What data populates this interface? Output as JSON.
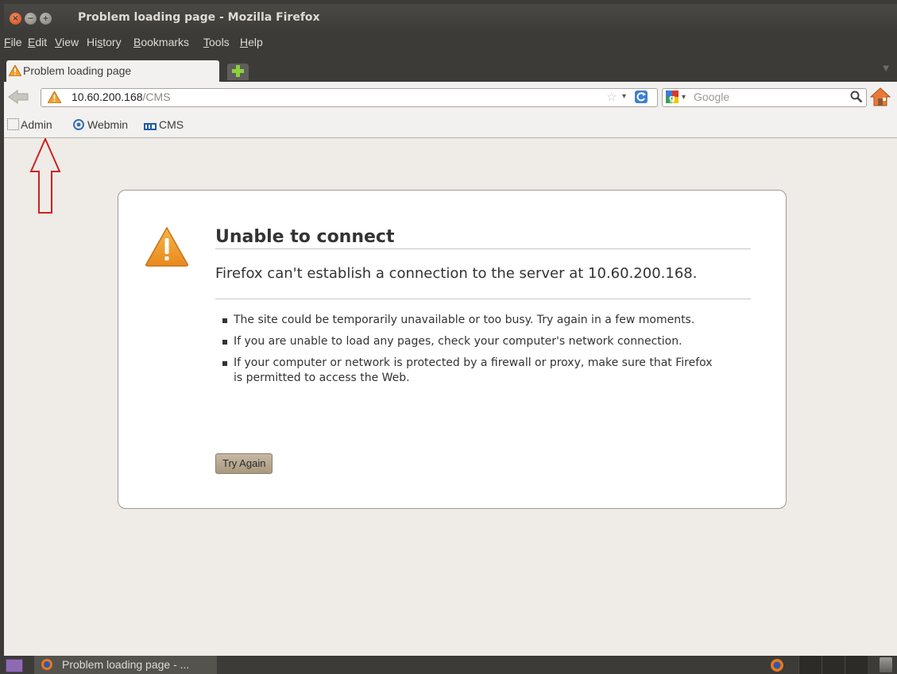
{
  "window": {
    "title": "Problem loading page - Mozilla Firefox",
    "close_glyph": "×",
    "min_glyph": "−",
    "max_glyph": "+"
  },
  "menu": {
    "items": [
      {
        "label": "File",
        "accel": "F",
        "rest": "ile"
      },
      {
        "label": "Edit",
        "accel": "E",
        "rest": "dit"
      },
      {
        "label": "View",
        "accel": "V",
        "rest": "iew"
      },
      {
        "label": "History",
        "pre": "Hi",
        "accel": "s",
        "rest": "tory"
      },
      {
        "label": "Bookmarks",
        "accel": "B",
        "rest": "ookmarks"
      },
      {
        "label": "Tools",
        "accel": "T",
        "rest": "ools"
      },
      {
        "label": "Help",
        "accel": "H",
        "rest": "elp"
      }
    ]
  },
  "tabs": {
    "active_label": "Problem loading page",
    "list_glyph": "▼"
  },
  "nav": {
    "url_host": "10.60.200.168",
    "url_path": "/CMS",
    "star_glyph": "☆",
    "drop_glyph": "▾",
    "search_placeholder": "Google",
    "search_drop_glyph": "▾"
  },
  "bookmarks": {
    "items": [
      "Admin",
      "Webmin",
      "CMS"
    ]
  },
  "error": {
    "title": "Unable to connect",
    "description": "Firefox can't establish a connection to the server at 10.60.200.168.",
    "reasons": [
      "The site could be temporarily unavailable or too busy. Try again in a few moments.",
      "If you are unable to load any pages, check your computer's network connection.",
      "If your computer or network is protected by a firewall or proxy, make sure that Firefox is permitted to access the Web."
    ],
    "try_again_label": "Try Again"
  },
  "taskbar": {
    "task_label": "Problem loading page - ..."
  },
  "colors": {
    "accent_warning": "#f0a030",
    "annotation_arrow": "#cc2222",
    "titlebar_bg": "#3c3b37"
  }
}
